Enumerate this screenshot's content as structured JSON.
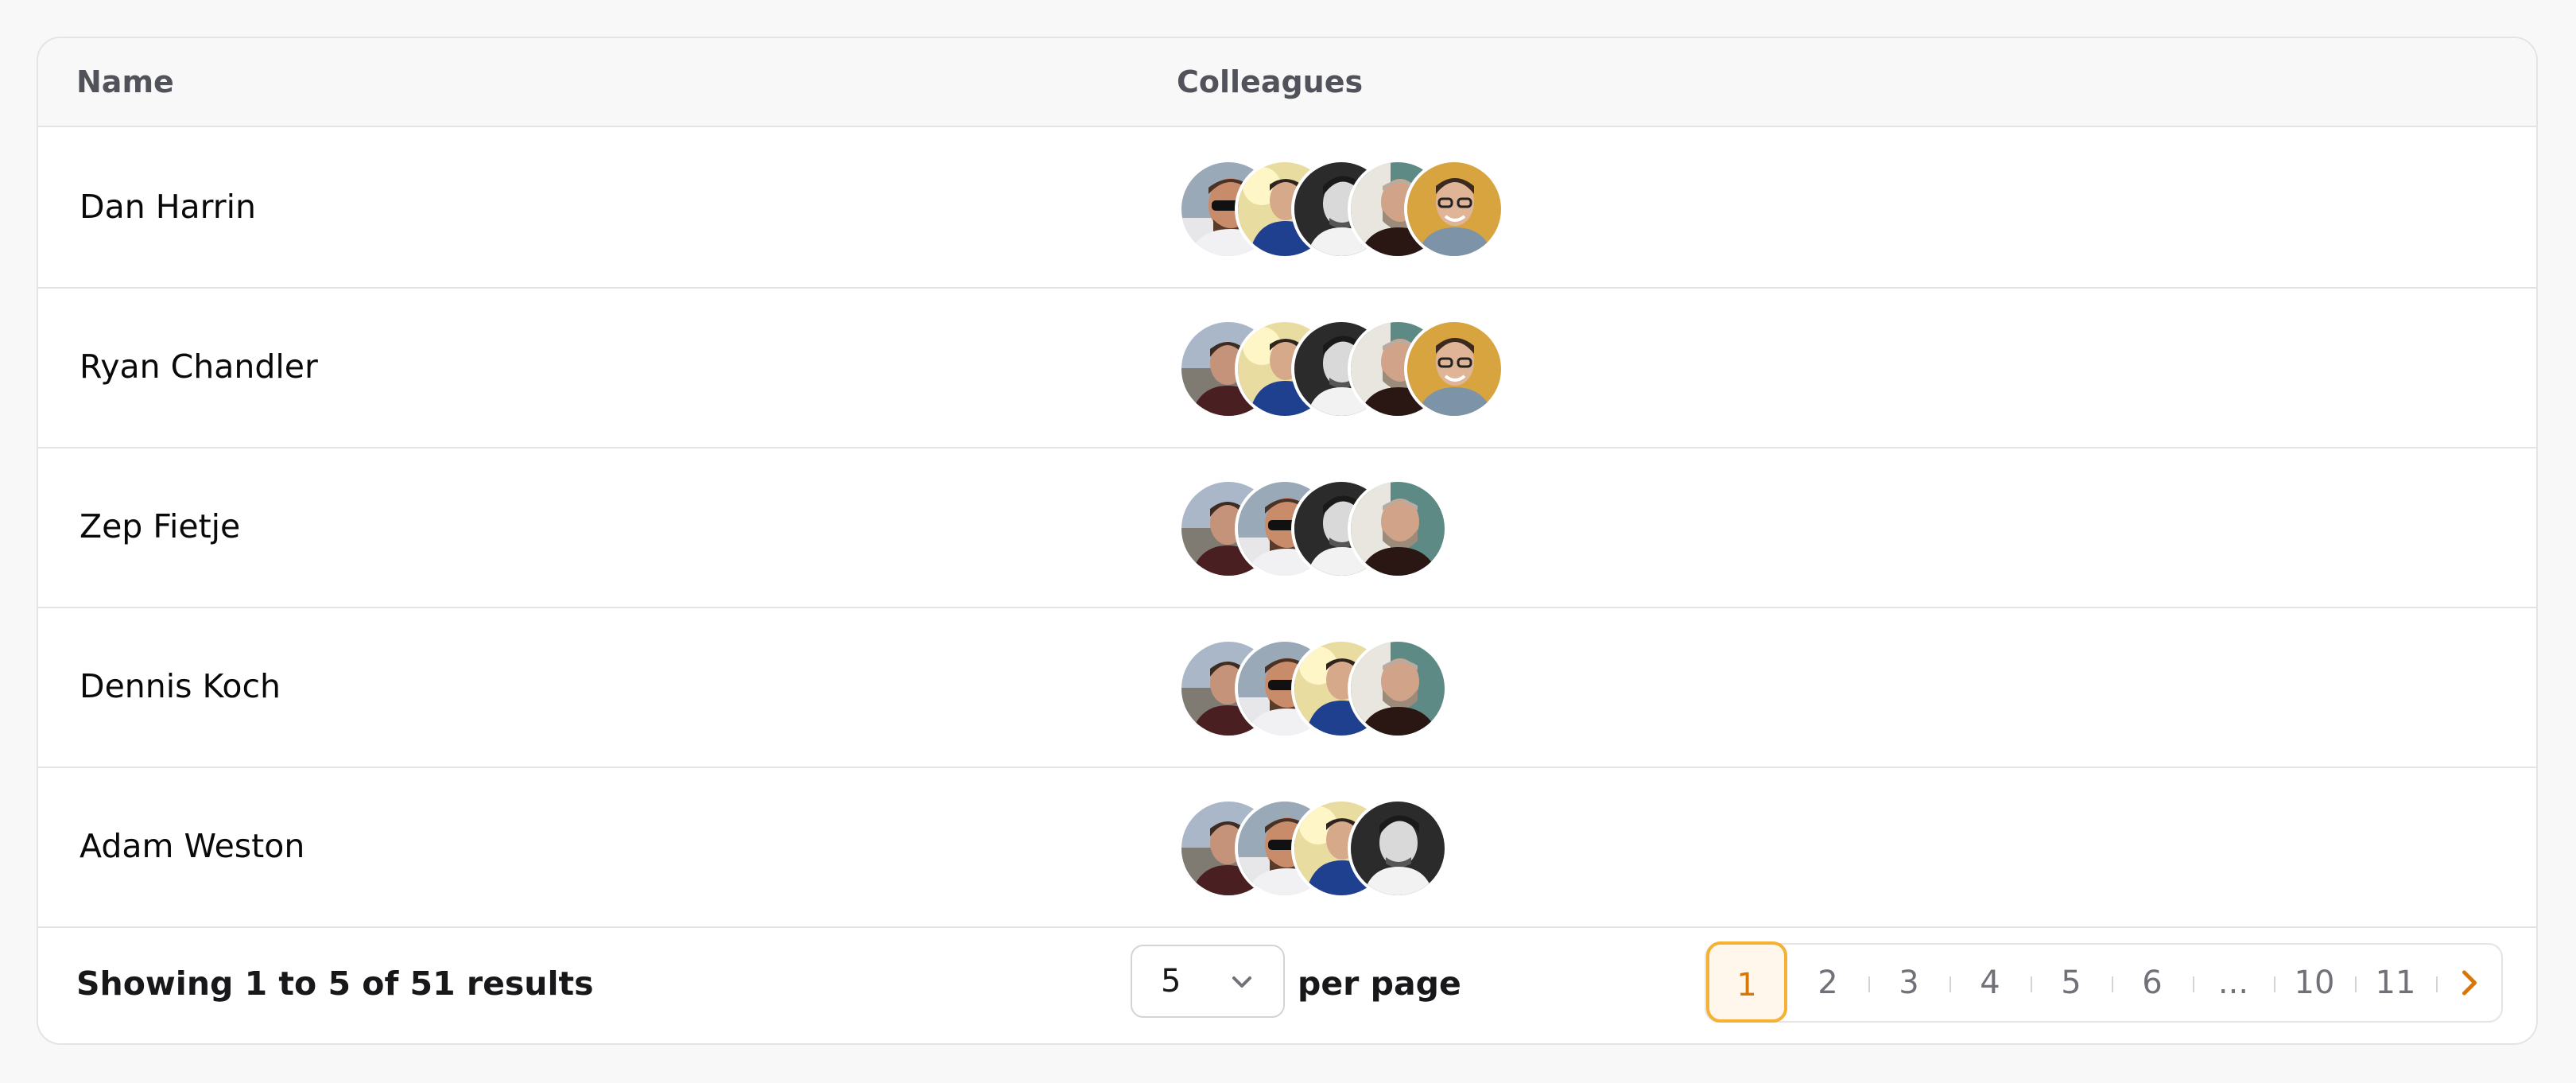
{
  "table": {
    "columns": {
      "name": "Name",
      "colleagues": "Colleagues"
    },
    "rows": [
      {
        "name": "Dan Harrin",
        "colleagues": [
          "sunglasses-man-avatar",
          "blue-sweater-man-avatar",
          "bw-portrait-man-avatar",
          "bearded-man-avatar",
          "smiling-man-yellow-avatar"
        ]
      },
      {
        "name": "Ryan Chandler",
        "colleagues": [
          "city-man-avatar",
          "blue-sweater-man-avatar",
          "bw-portrait-man-avatar",
          "bearded-man-avatar",
          "smiling-man-yellow-avatar"
        ]
      },
      {
        "name": "Zep Fietje",
        "colleagues": [
          "city-man-avatar",
          "sunglasses-man-avatar",
          "bw-portrait-man-avatar",
          "bearded-man-avatar"
        ]
      },
      {
        "name": "Dennis Koch",
        "colleagues": [
          "city-man-avatar",
          "sunglasses-man-avatar",
          "blue-sweater-man-avatar",
          "bearded-man-avatar"
        ]
      },
      {
        "name": "Adam Weston",
        "colleagues": [
          "city-man-avatar",
          "sunglasses-man-avatar",
          "blue-sweater-man-avatar",
          "bw-portrait-man-avatar"
        ]
      }
    ]
  },
  "pagination": {
    "summary": "Showing 1 to 5 of 51 results",
    "per_page_value": "5",
    "per_page_label": "per page",
    "pages": [
      "1",
      "2",
      "3",
      "4",
      "5",
      "6",
      "...",
      "10",
      "11"
    ],
    "current_page": "1",
    "accent_color": "#d97706"
  }
}
